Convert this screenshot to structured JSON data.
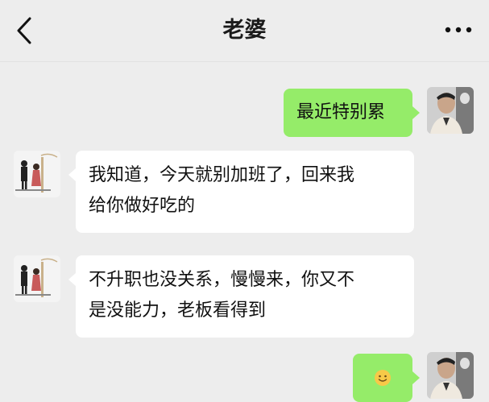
{
  "header": {
    "title": "老婆",
    "back_icon": "chevron-left-icon",
    "more_icon": "more-dots-icon"
  },
  "messages": [
    {
      "side": "right",
      "text": "最近特别累"
    },
    {
      "side": "left",
      "lines": [
        "我知道，今天就别加班了，回来我",
        "给你做好吃的"
      ]
    },
    {
      "side": "left",
      "lines": [
        "不升职也没关系，慢慢来，你又不",
        "是没能力，老板看得到"
      ]
    },
    {
      "side": "right",
      "emoji": "smile-emoji-icon"
    }
  ],
  "colors": {
    "background": "#ededed",
    "sent_bubble": "#95ec69",
    "received_bubble": "#ffffff"
  }
}
